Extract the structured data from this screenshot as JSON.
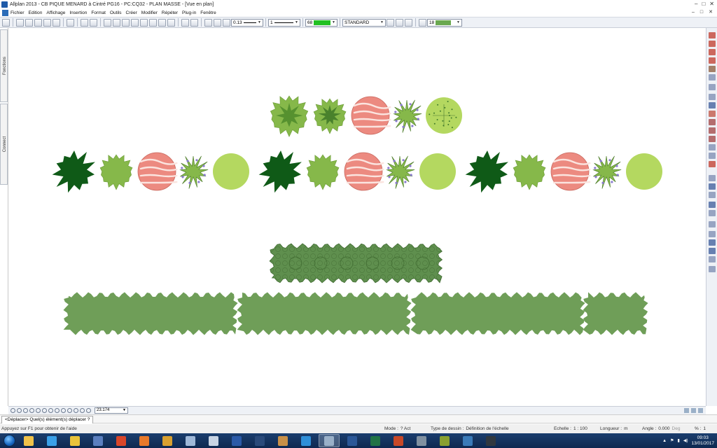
{
  "window": {
    "title": "Allplan 2013 - CB PIQUE MENARD à Cintré PG16 - PC:CQ32 - PLAN MASSE - [Vue en plan]",
    "controls": [
      "–",
      "□",
      "✕"
    ]
  },
  "menubar": {
    "items": [
      "Fichier",
      "Edition",
      "Affichage",
      "Insertion",
      "Format",
      "Outils",
      "Créer",
      "Modifier",
      "Répéter",
      "Plug-in",
      "Fenêtre"
    ],
    "controls": [
      "–",
      "□",
      "✕"
    ]
  },
  "toolbar": {
    "pen_thickness": "0.13",
    "line_type": "1",
    "color_number": "68",
    "color_hex": "#22c022",
    "layer": "STANDARD",
    "pattern_number": "18",
    "pattern_hex": "#6aa84f"
  },
  "left_tabs": [
    "Fonctions",
    "Connect"
  ],
  "bottom_toolbar": {
    "zoom_value": "23.174"
  },
  "prompt_tab": "<Déplacer> Quel(s) élément(s) déplacer ?",
  "statusbar": {
    "help": "Appuyez sur F1 pour obtenir de l'aide",
    "mode_label": "Mode :",
    "mode_value": "? Act",
    "drawing_type_label": "Type de dessin :",
    "drawing_type_value": "Définition de l'échelle",
    "scale_label": "Echelle :",
    "scale_value": "1 : 100",
    "length_label": "Longueur :",
    "length_value": "m",
    "angle_label": "Angle :",
    "angle_value": "0.000",
    "angle_unit": "Deg",
    "percent_label": "% :",
    "percent_value": "1"
  },
  "taskbar": {
    "time": "09:03",
    "date": "13/01/2017",
    "apps": [
      {
        "icon": "explorer-icon",
        "color": "#f0c24a",
        "active": false
      },
      {
        "icon": "ie-icon",
        "color": "#3aa0e8",
        "active": false
      },
      {
        "icon": "chrome-icon",
        "color": "#e8c33a",
        "active": false
      },
      {
        "icon": "outlook-icon",
        "color": "#5b7fbf",
        "active": false
      },
      {
        "icon": "ccleaner-icon",
        "color": "#d9462a",
        "active": false
      },
      {
        "icon": "firefox-icon",
        "color": "#e8792a",
        "active": false
      },
      {
        "icon": "paint-icon",
        "color": "#d8a030",
        "active": false
      },
      {
        "icon": "screenshot-icon",
        "color": "#9fb8d8",
        "active": false
      },
      {
        "icon": "window-icon",
        "color": "#c8d4e4",
        "active": false
      },
      {
        "icon": "photoshop-icon",
        "color": "#2b5aa8",
        "active": false
      },
      {
        "icon": "cinema4d-icon",
        "color": "#2a4a7a",
        "active": false
      },
      {
        "icon": "box-icon",
        "color": "#c89048",
        "active": false
      },
      {
        "icon": "teamviewer-icon",
        "color": "#2f8fd8",
        "active": false
      },
      {
        "icon": "allplan-icon",
        "color": "#9ab0c8",
        "active": true
      },
      {
        "icon": "word-icon",
        "color": "#2b5797",
        "active": false
      },
      {
        "icon": "excel-icon",
        "color": "#217346",
        "active": false
      },
      {
        "icon": "sketchup-icon",
        "color": "#c84828",
        "active": false
      },
      {
        "icon": "print-icon",
        "color": "#8090a0",
        "active": false
      },
      {
        "icon": "w-app-icon",
        "color": "#88a030",
        "active": false
      },
      {
        "icon": "network-icon",
        "color": "#3a7ab8",
        "active": false
      },
      {
        "icon": "stylus-icon",
        "color": "#303840",
        "active": false
      }
    ]
  },
  "plant_colors": {
    "dark_green": "#0f5a17",
    "mid_green": "#86b84a",
    "light_green": "#b4d860",
    "salmon": "#ec8a80",
    "hedge_green": "#6f9e58",
    "hedge_dark": "#5f8f4e"
  }
}
